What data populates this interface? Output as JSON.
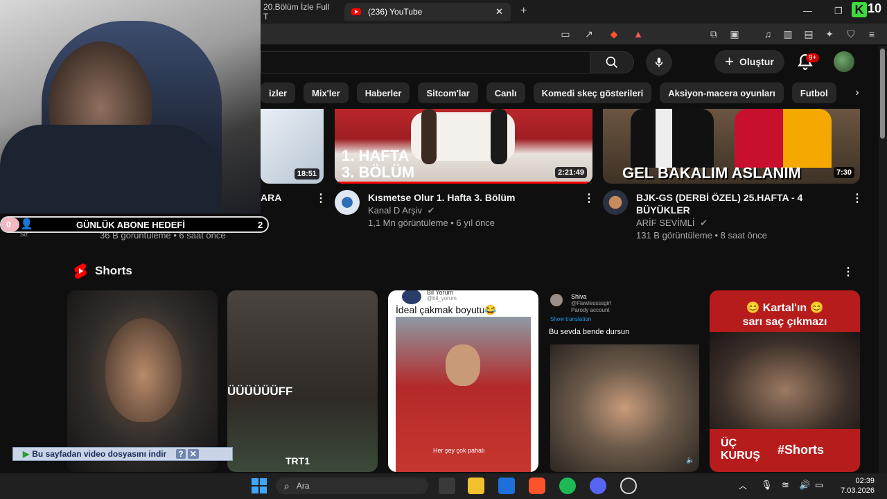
{
  "browser": {
    "tabs": [
      {
        "label": "20.Bölüm İzle Full T"
      },
      {
        "label": "(236) YouTube"
      }
    ],
    "k_score": "10"
  },
  "youtube": {
    "create_label": "Oluştur",
    "notifications": "9+",
    "chips": [
      "izler",
      "Mix'ler",
      "Haberler",
      "Sitcom'lar",
      "Canlı",
      "Komedi skeç gösterileri",
      "Aksiyon-macera oyunları",
      "Futbol"
    ],
    "videos": [
      {
        "thumb_text": "",
        "duration": "18:51",
        "title": "ARA",
        "channel": "",
        "meta": "36 B görüntüleme • 6 saat önce"
      },
      {
        "thumb_text_line1": "1. HAFTA",
        "thumb_text_line2": "3. BÖLÜM",
        "duration": "2:21:49",
        "title": "Kısmetse Olur 1. Hafta 3. Bölüm",
        "channel": "Kanal D Arşiv",
        "meta": "1,1 Mn görüntüleme • 6 yıl önce"
      },
      {
        "thumb_text": "GEL BAKALIM ASLANIM",
        "duration": "7:30",
        "title_line1": "BJK-GS (DERBİ ÖZEL) 25.HAFTA - 4",
        "title_line2": "BÜYÜKLER",
        "channel": "ARİF SEVİMLİ",
        "meta": "131 B görüntüleme • 8 saat önce"
      }
    ],
    "shorts": {
      "heading": "Shorts",
      "items": [
        {
          "overlay": ""
        },
        {
          "overlay": "ÜÜÜÜÜÜFF",
          "watermark": "TRT1"
        },
        {
          "user": "Bil Yorum",
          "handle": "@bil_yorum",
          "caption": "İdeal çakmak boyutu😂",
          "sub": "Her şey çok pahalı"
        },
        {
          "user": "Shiva",
          "handle": "@Flawlessssgirl",
          "parody": "Parody account",
          "translate": "Show translation",
          "caption": "Bu sevda bende dursun"
        },
        {
          "top_line1": "😊 Kartal'ın 😊",
          "top_line2": "sarı saç çıkmazı",
          "bottom_line1": "ÜÇ",
          "bottom_line2": "KURUŞ",
          "tag": "#Shorts"
        }
      ]
    }
  },
  "overlay": {
    "goal_label": "GÜNLÜK ABONE HEDEFİ",
    "goal_current": "0",
    "goal_target": "2",
    "goal_sub": "Siz",
    "download_label": "Bu sayfadan video dosyasını indir",
    "download_help": "?"
  },
  "taskbar": {
    "search_placeholder": "Ara",
    "time": "02:39",
    "date": "7.03.2026"
  },
  "colors": {
    "accent_red": "#ff0000",
    "badge_red": "#cc0000",
    "k_green": "#3ddc3d"
  }
}
